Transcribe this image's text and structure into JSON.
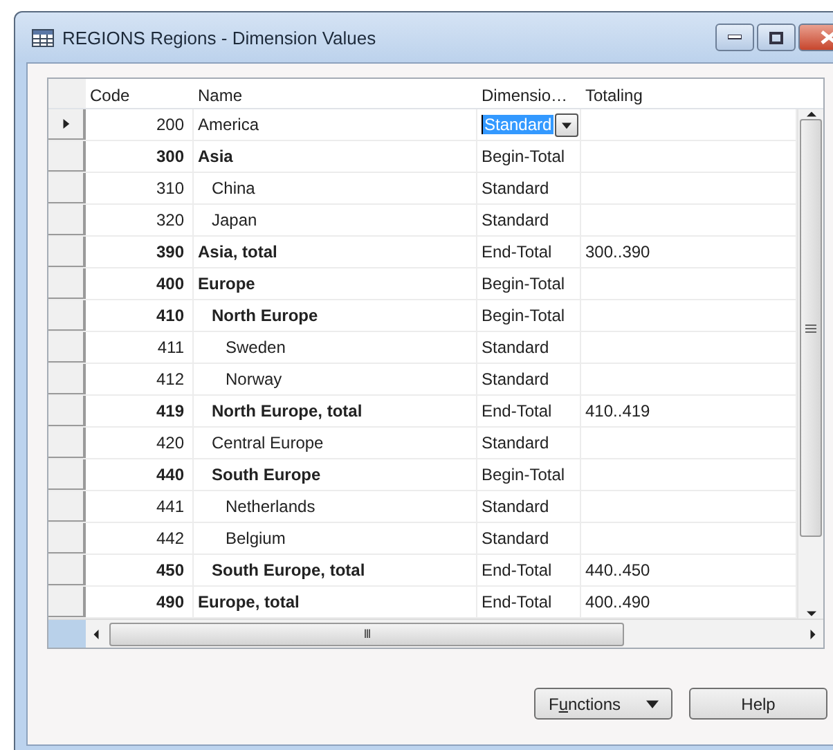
{
  "window": {
    "title": "REGIONS Regions - Dimension Values"
  },
  "table": {
    "columns": [
      "Code",
      "Name",
      "Dimensio…",
      "Totaling"
    ],
    "rows": [
      {
        "code": "200",
        "name": "America",
        "type": "Standard",
        "bold": false,
        "selected": true
      },
      {
        "code": "300",
        "name": "Asia",
        "type": "Begin-Total",
        "bold": true,
        "selected": false,
        "children": [
          {
            "code": "310",
            "name": "China",
            "type": "Standard",
            "bold": false,
            "selected": false
          },
          {
            "code": "320",
            "name": "Japan",
            "type": "Standard",
            "bold": false,
            "selected": false
          }
        ]
      },
      {
        "code": "390",
        "name": "Asia, total",
        "type": "End-Total",
        "totaling": "300..390",
        "bold": true,
        "selected": false
      },
      {
        "code": "400",
        "name": "Europe",
        "type": "Begin-Total",
        "bold": true,
        "selected": false,
        "children": [
          {
            "code": "410",
            "name": "North Europe",
            "type": "Begin-Total",
            "bold": true,
            "selected": false,
            "children": [
              {
                "code": "411",
                "name": "Sweden",
                "type": "Standard",
                "bold": false,
                "selected": false
              },
              {
                "code": "412",
                "name": "Norway",
                "type": "Standard",
                "bold": false,
                "selected": false
              }
            ]
          },
          {
            "code": "419",
            "name": "North Europe, total",
            "type": "End-Total",
            "totaling": "410..419",
            "bold": true,
            "selected": false
          },
          {
            "code": "420",
            "name": "Central Europe",
            "type": "Standard",
            "bold": false,
            "selected": false
          },
          {
            "code": "440",
            "name": "South Europe",
            "type": "Begin-Total",
            "bold": true,
            "selected": false,
            "children": [
              {
                "code": "441",
                "name": "Netherlands",
                "type": "Standard",
                "bold": false,
                "selected": false
              },
              {
                "code": "442",
                "name": "Belgium",
                "type": "Standard",
                "bold": false,
                "selected": false
              }
            ]
          },
          {
            "code": "450",
            "name": "South Europe, total",
            "type": "End-Total",
            "totaling": "440..450",
            "bold": true,
            "selected": false
          }
        ]
      },
      {
        "code": "490",
        "name": "Europe, total",
        "type": "End-Total",
        "totaling": "400..490",
        "bold": true,
        "selected": false
      }
    ]
  },
  "hscroll_thumb": "III",
  "buttons": [
    {
      "kind": "menu",
      "label_parts": [
        "F",
        "u",
        "nctions"
      ]
    },
    {
      "kind": "plain",
      "label": "Help"
    }
  ]
}
